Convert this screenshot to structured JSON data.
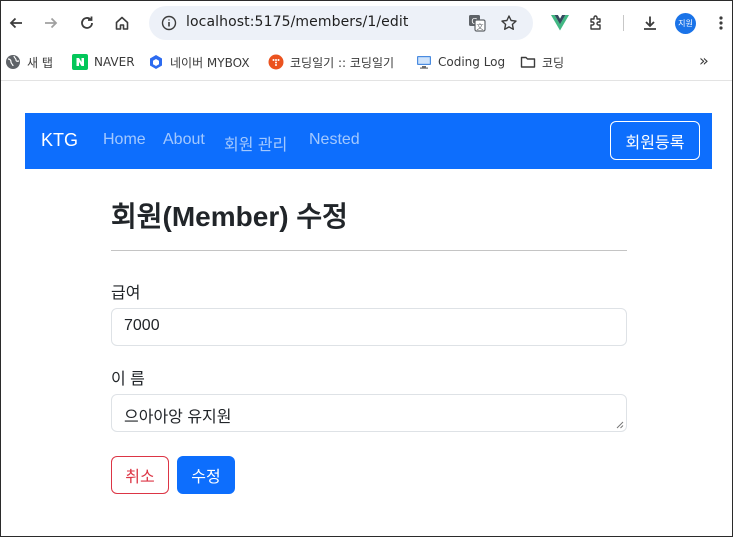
{
  "browser": {
    "url": "localhost:5175/members/1/edit",
    "profile_initials": "지원",
    "bookmarks": [
      {
        "label": "새 탭"
      },
      {
        "label": "NAVER"
      },
      {
        "label": "네이버 MYBOX"
      },
      {
        "label": "코딩일기 :: 코딩일기"
      },
      {
        "label": "Coding Log"
      },
      {
        "label": "코딩"
      }
    ],
    "more_label": "»"
  },
  "navbar": {
    "brand": "KTG",
    "links": [
      {
        "label": "Home"
      },
      {
        "label": "About"
      },
      {
        "label": "회원 관리"
      },
      {
        "label": "Nested"
      }
    ],
    "register_button": "회원등록"
  },
  "form": {
    "title": "회원(Member) 수정",
    "salary_label": "급여",
    "salary_value": "7000",
    "name_label": "이 름",
    "name_value": "으아아앙 유지원",
    "cancel_label": "취소",
    "submit_label": "수정"
  },
  "colors": {
    "primary": "#0d6efd",
    "danger": "#dc3545"
  }
}
